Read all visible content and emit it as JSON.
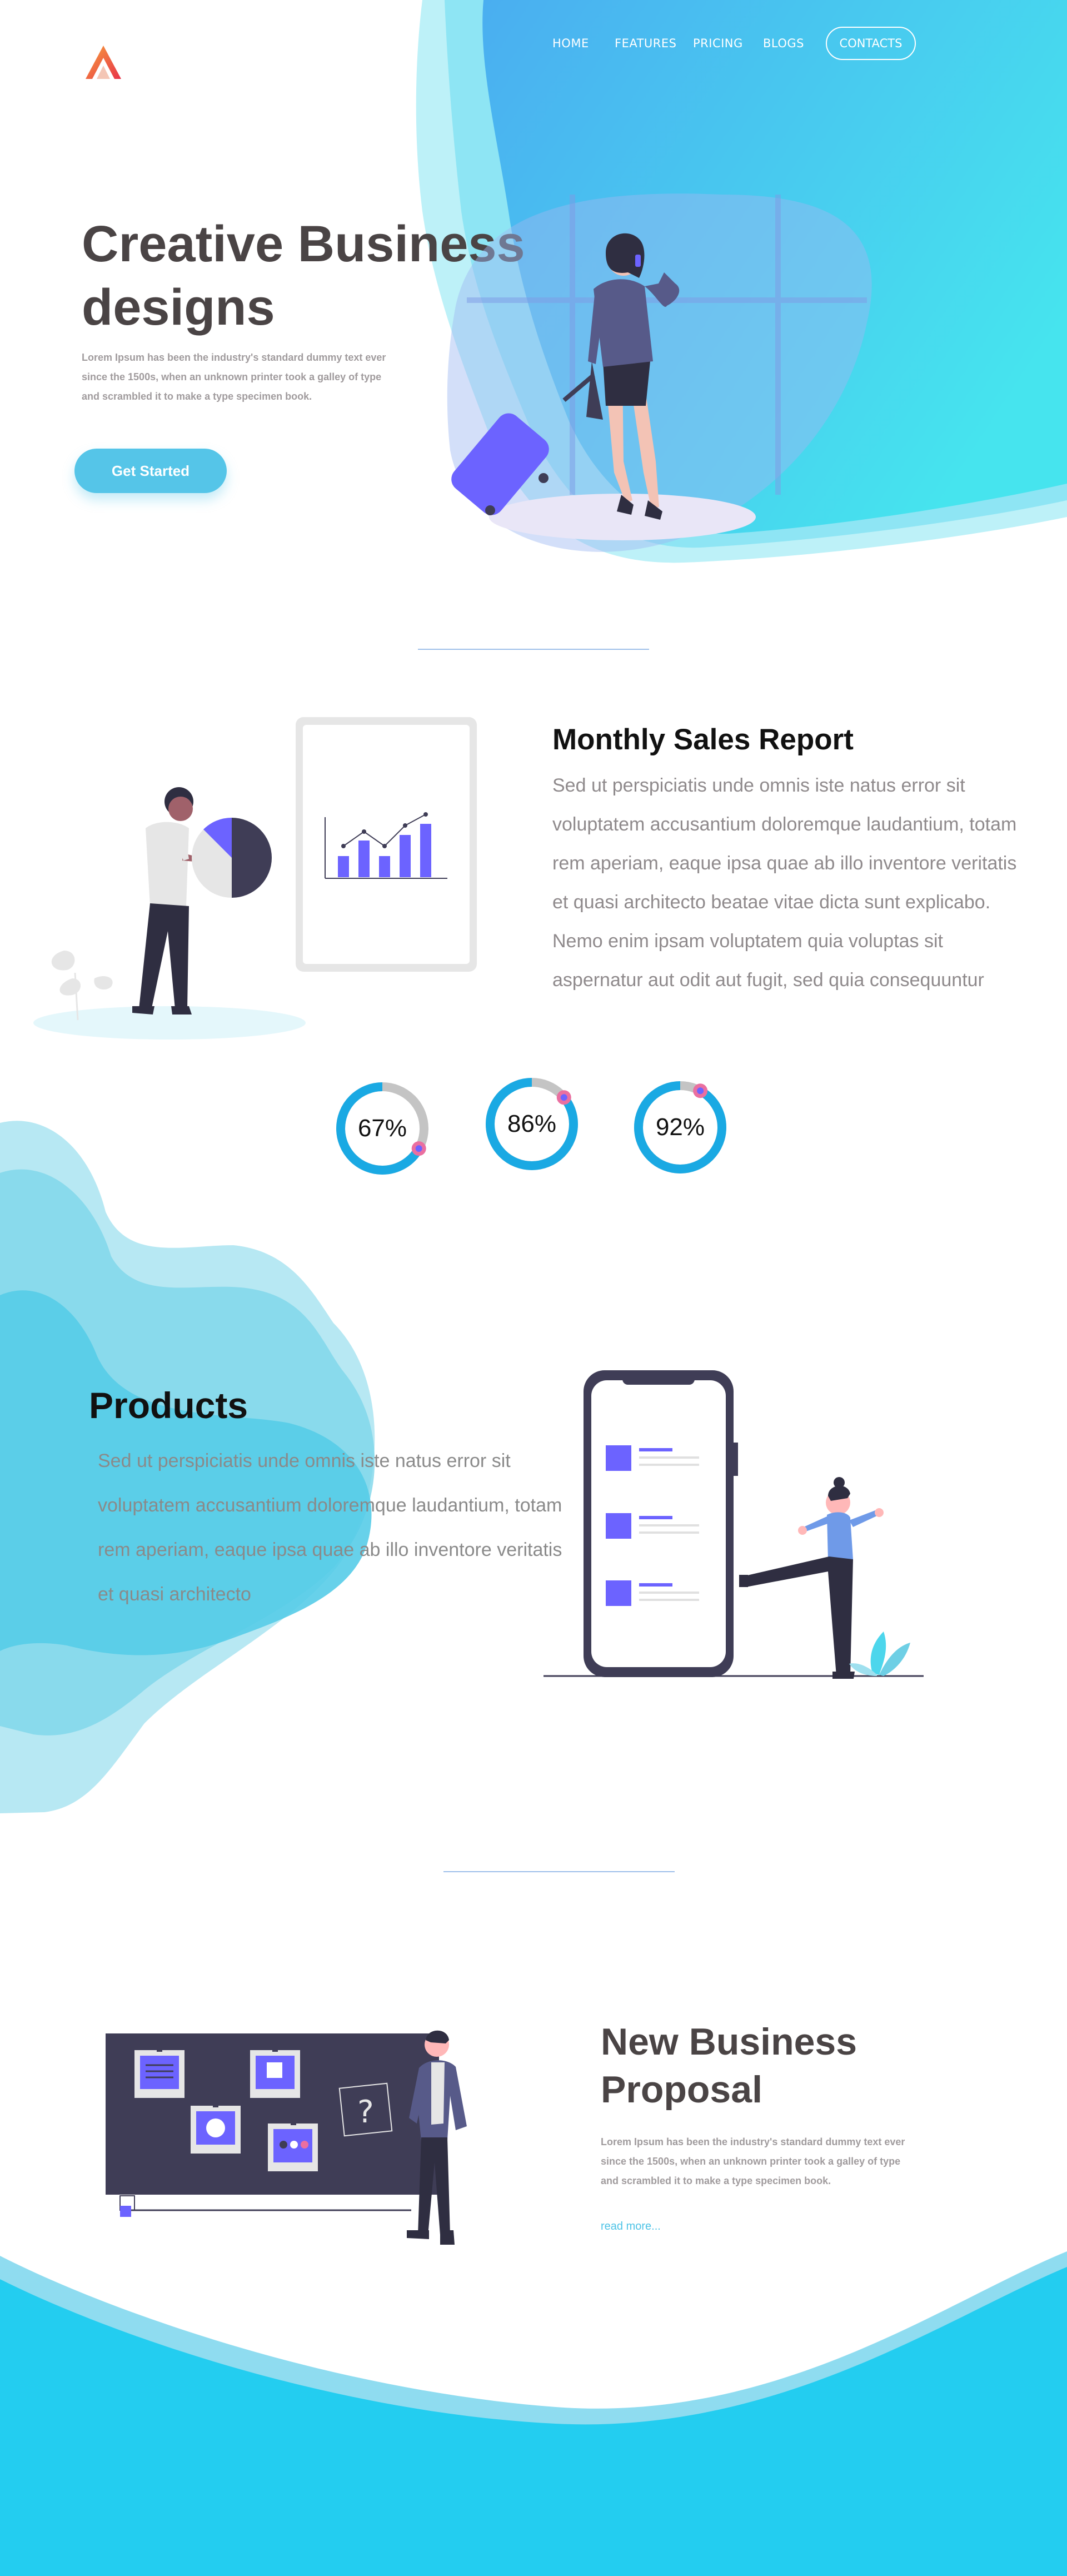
{
  "nav": {
    "home": "HOME",
    "features": "FEATURES",
    "pricing": "PRICING",
    "blogs": "BLOGS",
    "contacts": "CONTACTS"
  },
  "hero": {
    "title_line1": "Creative Business",
    "title_line2": "designs",
    "description": "Lorem Ipsum has been the industry's standard dummy text ever since the 1500s, when an unknown printer took a galley of type and scrambled it to make a type specimen book.",
    "cta_label": "Get Started"
  },
  "sales": {
    "title": "Monthly Sales Report",
    "text": "Sed ut perspiciatis unde omnis iste natus error sit voluptatem accusantium doloremque laudantium, totam rem aperiam, eaque ipsa quae ab illo inventore veritatis et quasi architecto beatae vitae dicta sunt explicabo. Nemo enim ipsam voluptatem quia voluptas sit aspernatur aut odit aut fugit, sed quia consequuntur",
    "stats": [
      {
        "label": "67%",
        "value": 67
      },
      {
        "label": "86%",
        "value": 86
      },
      {
        "label": "92%",
        "value": 92
      }
    ]
  },
  "products": {
    "title": "Products",
    "text": "Sed ut perspiciatis unde omnis iste natus error sit voluptatem accusantium doloremque laudantium, totam rem aperiam, eaque ipsa quae ab illo inventore veritatis et quasi architecto"
  },
  "proposal": {
    "title": "New Business Proposal",
    "description": "Lorem Ipsum has been the industry's standard dummy text ever since the 1500s, when an unknown printer took a galley of type and scrambled it to make a type specimen book.",
    "read_more": "read more..."
  },
  "colors": {
    "accent_cyan": "#4dd6ec",
    "brand_purple": "#6c63ff",
    "footer_blue": "#23cdf0",
    "donut_blue": "#1aa9e3",
    "donut_gray": "#c4c4c4",
    "donut_knob": "#ea6fa0"
  },
  "icons": {
    "logo": "a-triangle-logo"
  }
}
